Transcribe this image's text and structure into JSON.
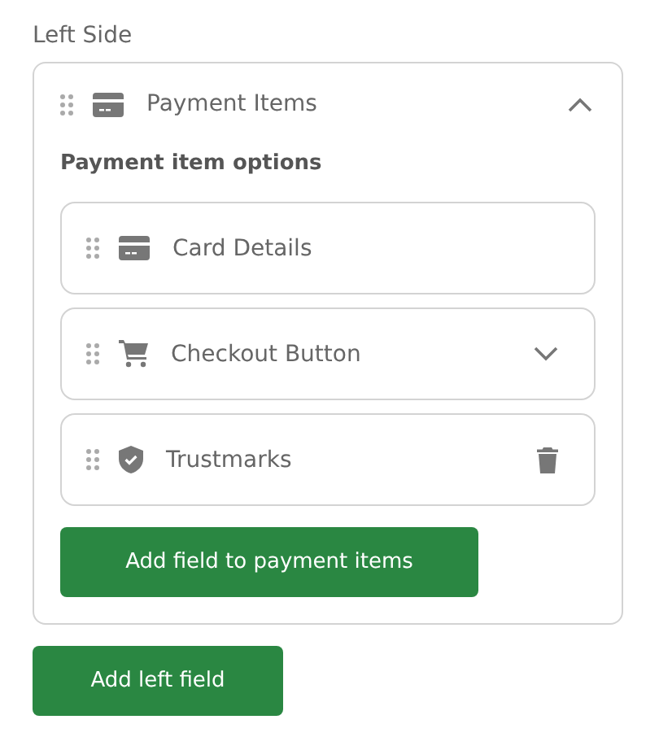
{
  "section_label": "Left Side",
  "panel": {
    "title": "Payment Items",
    "expanded": true,
    "options_heading": "Payment item options",
    "items": [
      {
        "label": "Card Details",
        "kind": "card"
      },
      {
        "label": "Checkout Button",
        "kind": "checkout"
      },
      {
        "label": "Trustmarks",
        "kind": "trustmark"
      }
    ],
    "add_button": "Add field to payment items"
  },
  "add_button": "Add left field"
}
